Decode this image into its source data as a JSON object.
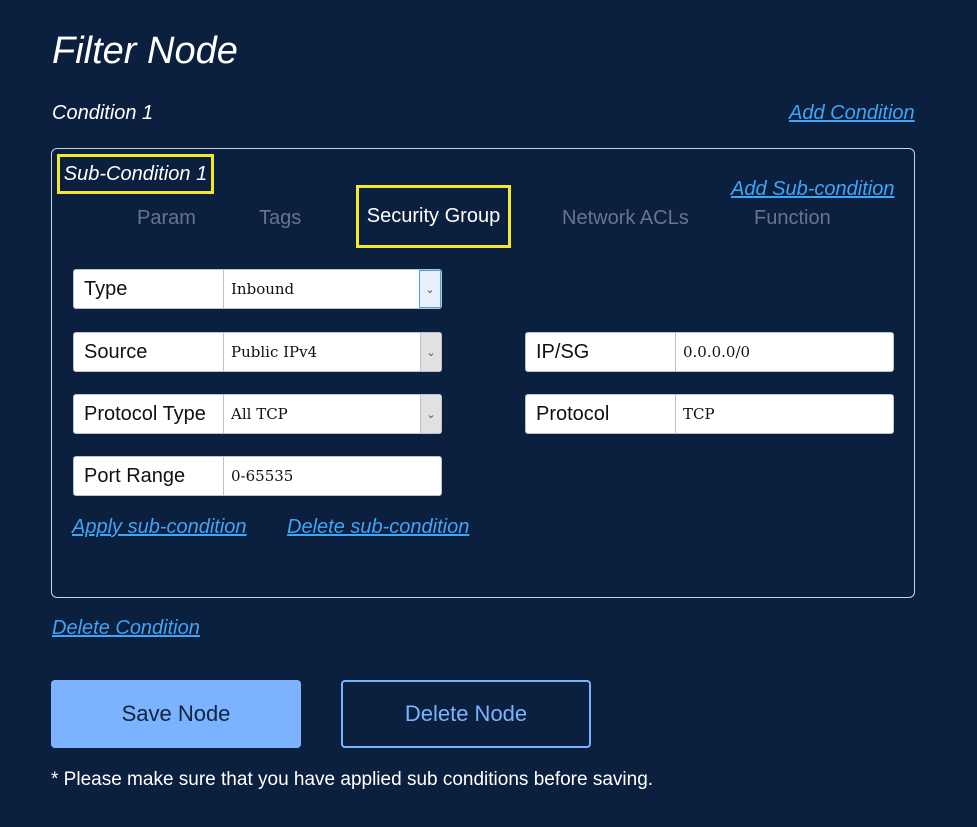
{
  "header": {
    "title": "Filter Node"
  },
  "condition": {
    "label": "Condition 1",
    "add_condition": "Add Condition",
    "delete_condition": "Delete Condition"
  },
  "subcondition": {
    "label": "Sub-Condition 1",
    "add_subcondition": "Add Sub-condition",
    "tabs": [
      {
        "label": "Param"
      },
      {
        "label": "Tags"
      },
      {
        "label": "Security Group",
        "active": true
      },
      {
        "label": "Network ACLs"
      },
      {
        "label": "Function"
      }
    ],
    "fields": {
      "type": {
        "label": "Type",
        "value": "Inbound"
      },
      "source": {
        "label": "Source",
        "value": "Public IPv4"
      },
      "protocol_type": {
        "label": "Protocol Type",
        "value": "All TCP"
      },
      "port_range": {
        "label": "Port Range",
        "value": "0-65535"
      },
      "ip_sg": {
        "label": "IP/SG",
        "value": "0.0.0.0/0"
      },
      "protocol": {
        "label": "Protocol",
        "value": "TCP"
      }
    },
    "apply": "Apply sub-condition",
    "delete": "Delete sub-condition"
  },
  "actions": {
    "save": "Save Node",
    "delete": "Delete Node"
  },
  "note": "* Please make sure that you have applied sub conditions before saving.",
  "colors": {
    "background": "#0b1f3e",
    "link": "#3ea5f7",
    "highlight": "#f5e82a",
    "primary": "#7cb3ff"
  }
}
